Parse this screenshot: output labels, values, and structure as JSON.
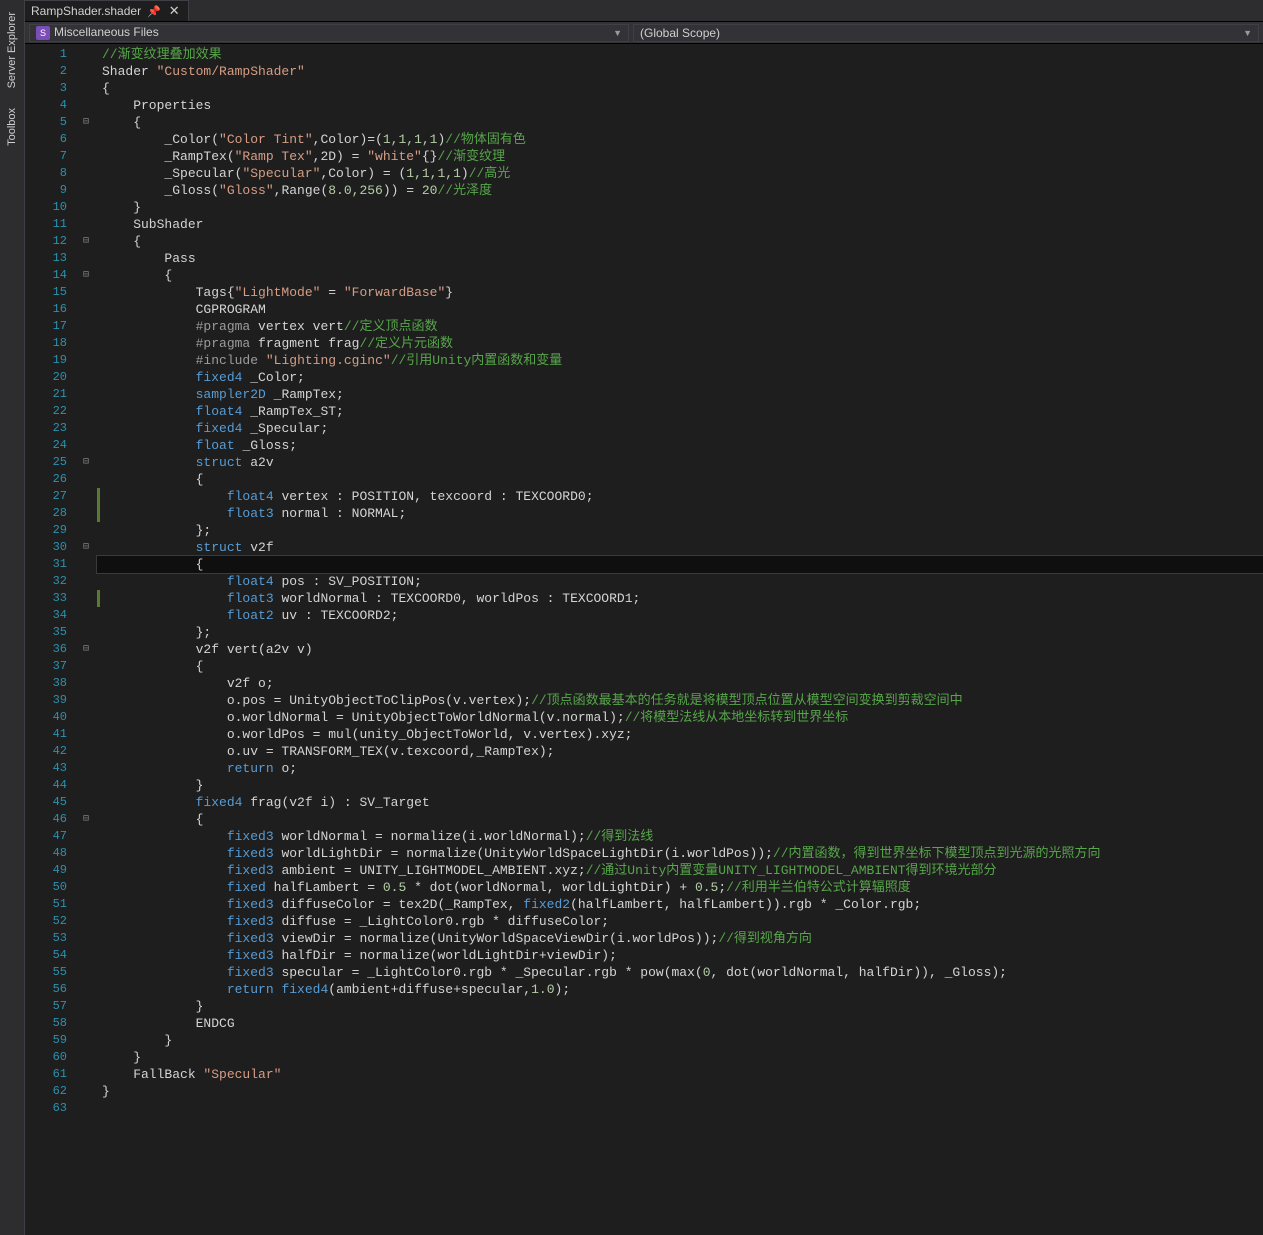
{
  "sidebar": {
    "items": [
      "Server Explorer",
      "Toolbox"
    ]
  },
  "tab": {
    "filename": "RampShader.shader",
    "pin_glyph": "📌",
    "close_glyph": "✕"
  },
  "context": {
    "project": "Miscellaneous Files",
    "scope": "(Global Scope)"
  },
  "line_numbers": [
    "1",
    "2",
    "3",
    "4",
    "5",
    "6",
    "7",
    "8",
    "9",
    "10",
    "11",
    "12",
    "13",
    "14",
    "15",
    "16",
    "17",
    "18",
    "19",
    "20",
    "21",
    "22",
    "23",
    "24",
    "25",
    "26",
    "27",
    "28",
    "29",
    "30",
    "31",
    "32",
    "33",
    "34",
    "35",
    "36",
    "37",
    "38",
    "39",
    "40",
    "41",
    "42",
    "43",
    "44",
    "45",
    "46",
    "47",
    "48",
    "49",
    "50",
    "51",
    "52",
    "53",
    "54",
    "55",
    "56",
    "57",
    "58",
    "59",
    "60",
    "61",
    "62",
    "63"
  ],
  "fold_rows": {
    "5": "⊟",
    "12": "⊟",
    "14": "⊟",
    "25": "⊟",
    "30": "⊟",
    "36": "⊟",
    "46": "⊟"
  },
  "changed_rows": [
    27,
    28,
    33
  ],
  "current_row": 31,
  "code": {
    "l1": {
      "t": "//渐变纹理叠加效果"
    },
    "l2a": "Shader ",
    "l2b": "\"Custom/RampShader\"",
    "l3": "{",
    "l4": "    Properties",
    "l5": "    {",
    "l6a": "        _Color(",
    "l6b": "\"Color Tint\"",
    "l6c": ",Color)=(",
    "l6d": "1,1,1,1",
    "l6e": ")",
    "l6f": "//物体固有色",
    "l7a": "        _RampTex(",
    "l7b": "\"Ramp Tex\"",
    "l7c": ",2D) = ",
    "l7d": "\"white\"",
    "l7e": "{}",
    "l7f": "//渐变纹理",
    "l8a": "        _Specular(",
    "l8b": "\"Specular\"",
    "l8c": ",Color) = (",
    "l8d": "1,1,1,1",
    "l8e": ")",
    "l8f": "//高光",
    "l9a": "        _Gloss(",
    "l9b": "\"Gloss\"",
    "l9c": ",Range(",
    "l9d": "8.0,256",
    "l9e": ")) = ",
    "l9f": "20",
    "l9g": "//光泽度",
    "l10": "    }",
    "l11": "    SubShader",
    "l12": "    {",
    "l13": "        Pass",
    "l14": "        {",
    "l15a": "            Tags{",
    "l15b": "\"LightMode\"",
    "l15c": " = ",
    "l15d": "\"ForwardBase\"",
    "l15e": "}",
    "l16": "            CGPROGRAM",
    "l17a": "            ",
    "l17b": "#pragma",
    "l17c": " vertex vert",
    "l17d": "//定义顶点函数",
    "l18a": "            ",
    "l18b": "#pragma",
    "l18c": " fragment frag",
    "l18d": "//定义片元函数",
    "l19a": "            ",
    "l19b": "#include",
    "l19c": " ",
    "l19d": "\"Lighting.cginc\"",
    "l19e": "//引用Unity内置函数和变量",
    "l20a": "            ",
    "l20b": "fixed4",
    "l20c": " _Color;",
    "l21a": "            ",
    "l21b": "sampler2D",
    "l21c": " _RampTex;",
    "l22a": "            ",
    "l22b": "float4",
    "l22c": " _RampTex_ST;",
    "l23a": "            ",
    "l23b": "fixed4",
    "l23c": " _Specular;",
    "l24a": "            ",
    "l24b": "float",
    "l24c": " _Gloss;",
    "l25a": "            ",
    "l25b": "struct",
    "l25c": " a2v",
    "l26": "            {",
    "l27a": "                ",
    "l27b": "float4",
    "l27c": " vertex : POSITION, texcoord : TEXCOORD0;",
    "l28a": "                ",
    "l28b": "float3",
    "l28c": " normal : NORMAL;",
    "l29": "            };",
    "l30a": "            ",
    "l30b": "struct",
    "l30c": " v2f",
    "l31": "            {",
    "l32a": "                ",
    "l32b": "float4",
    "l32c": " pos : SV_POSITION;",
    "l33a": "                ",
    "l33b": "float3",
    "l33c": " worldNormal : TEXCOORD0, worldPos : TEXCOORD1;",
    "l34a": "                ",
    "l34b": "float2",
    "l34c": " uv : TEXCOORD2;",
    "l35": "            };",
    "l36": "            v2f vert(a2v v)",
    "l37": "            {",
    "l38": "                v2f o;",
    "l39a": "                o.pos = UnityObjectToClipPos(v.vertex);",
    "l39b": "//顶点函数最基本的任务就是将模型顶点位置从模型空间变换到剪裁空间中",
    "l40a": "                o.worldNormal = UnityObjectToWorldNormal(v.normal);",
    "l40b": "//将模型法线从本地坐标转到世界坐标",
    "l41": "                o.worldPos = mul(unity_ObjectToWorld, v.vertex).xyz;",
    "l42": "                o.uv = TRANSFORM_TEX(v.texcoord,_RampTex);",
    "l43a": "                ",
    "l43b": "return",
    "l43c": " o;",
    "l44": "            }",
    "l45a": "            ",
    "l45b": "fixed4",
    "l45c": " frag(v2f i) : SV_Target",
    "l46": "            {",
    "l47a": "                ",
    "l47b": "fixed3",
    "l47c": " worldNormal = normalize(i.worldNormal);",
    "l47d": "//得到法线",
    "l48a": "                ",
    "l48b": "fixed3",
    "l48c": " worldLightDir = normalize(UnityWorldSpaceLightDir(i.worldPos));",
    "l48d": "//内置函数，得到世界坐标下模型顶点到光源的光照方向",
    "l49a": "                ",
    "l49b": "fixed3",
    "l49c": " ambient = UNITY_LIGHTMODEL_AMBIENT.xyz;",
    "l49d": "//通过Unity内置变量UNITY_LIGHTMODEL_AMBIENT得到环境光部分",
    "l50a": "                ",
    "l50b": "fixed",
    "l50c": " halfLambert = ",
    "l50d": "0.5",
    "l50e": " * dot(worldNormal, worldLightDir) + ",
    "l50f": "0.5",
    "l50g": ";",
    "l50h": "//利用半兰伯特公式计算辐照度",
    "l51a": "                ",
    "l51b": "fixed3",
    "l51c": " diffuseColor = tex2D(_RampTex, ",
    "l51d": "fixed2",
    "l51e": "(halfLambert, halfLambert)).rgb * _Color.rgb;",
    "l52a": "                ",
    "l52b": "fixed3",
    "l52c": " diffuse = _LightColor0.rgb * diffuseColor;",
    "l53a": "                ",
    "l53b": "fixed3",
    "l53c": " viewDir = normalize(UnityWorldSpaceViewDir(i.worldPos));",
    "l53d": "//得到视角方向",
    "l54a": "                ",
    "l54b": "fixed3",
    "l54c": " halfDir = normalize(worldLightDir+viewDir);",
    "l55a": "                ",
    "l55b": "fixed3",
    "l55c": " specular = _LightColor0.rgb * _Specular.rgb * pow(max(",
    "l55d": "0",
    "l55e": ", dot(worldNormal, halfDir)), _Gloss);",
    "l56a": "                ",
    "l56b": "return",
    "l56c": " ",
    "l56d": "fixed4",
    "l56e": "(ambient+diffuse+specular,",
    "l56f": "1.0",
    "l56g": ");",
    "l57": "            }",
    "l58": "            ENDCG",
    "l59": "        }",
    "l60": "    }",
    "l61a": "    FallBack ",
    "l61b": "\"Specular\"",
    "l62": "}",
    "l63": ""
  }
}
